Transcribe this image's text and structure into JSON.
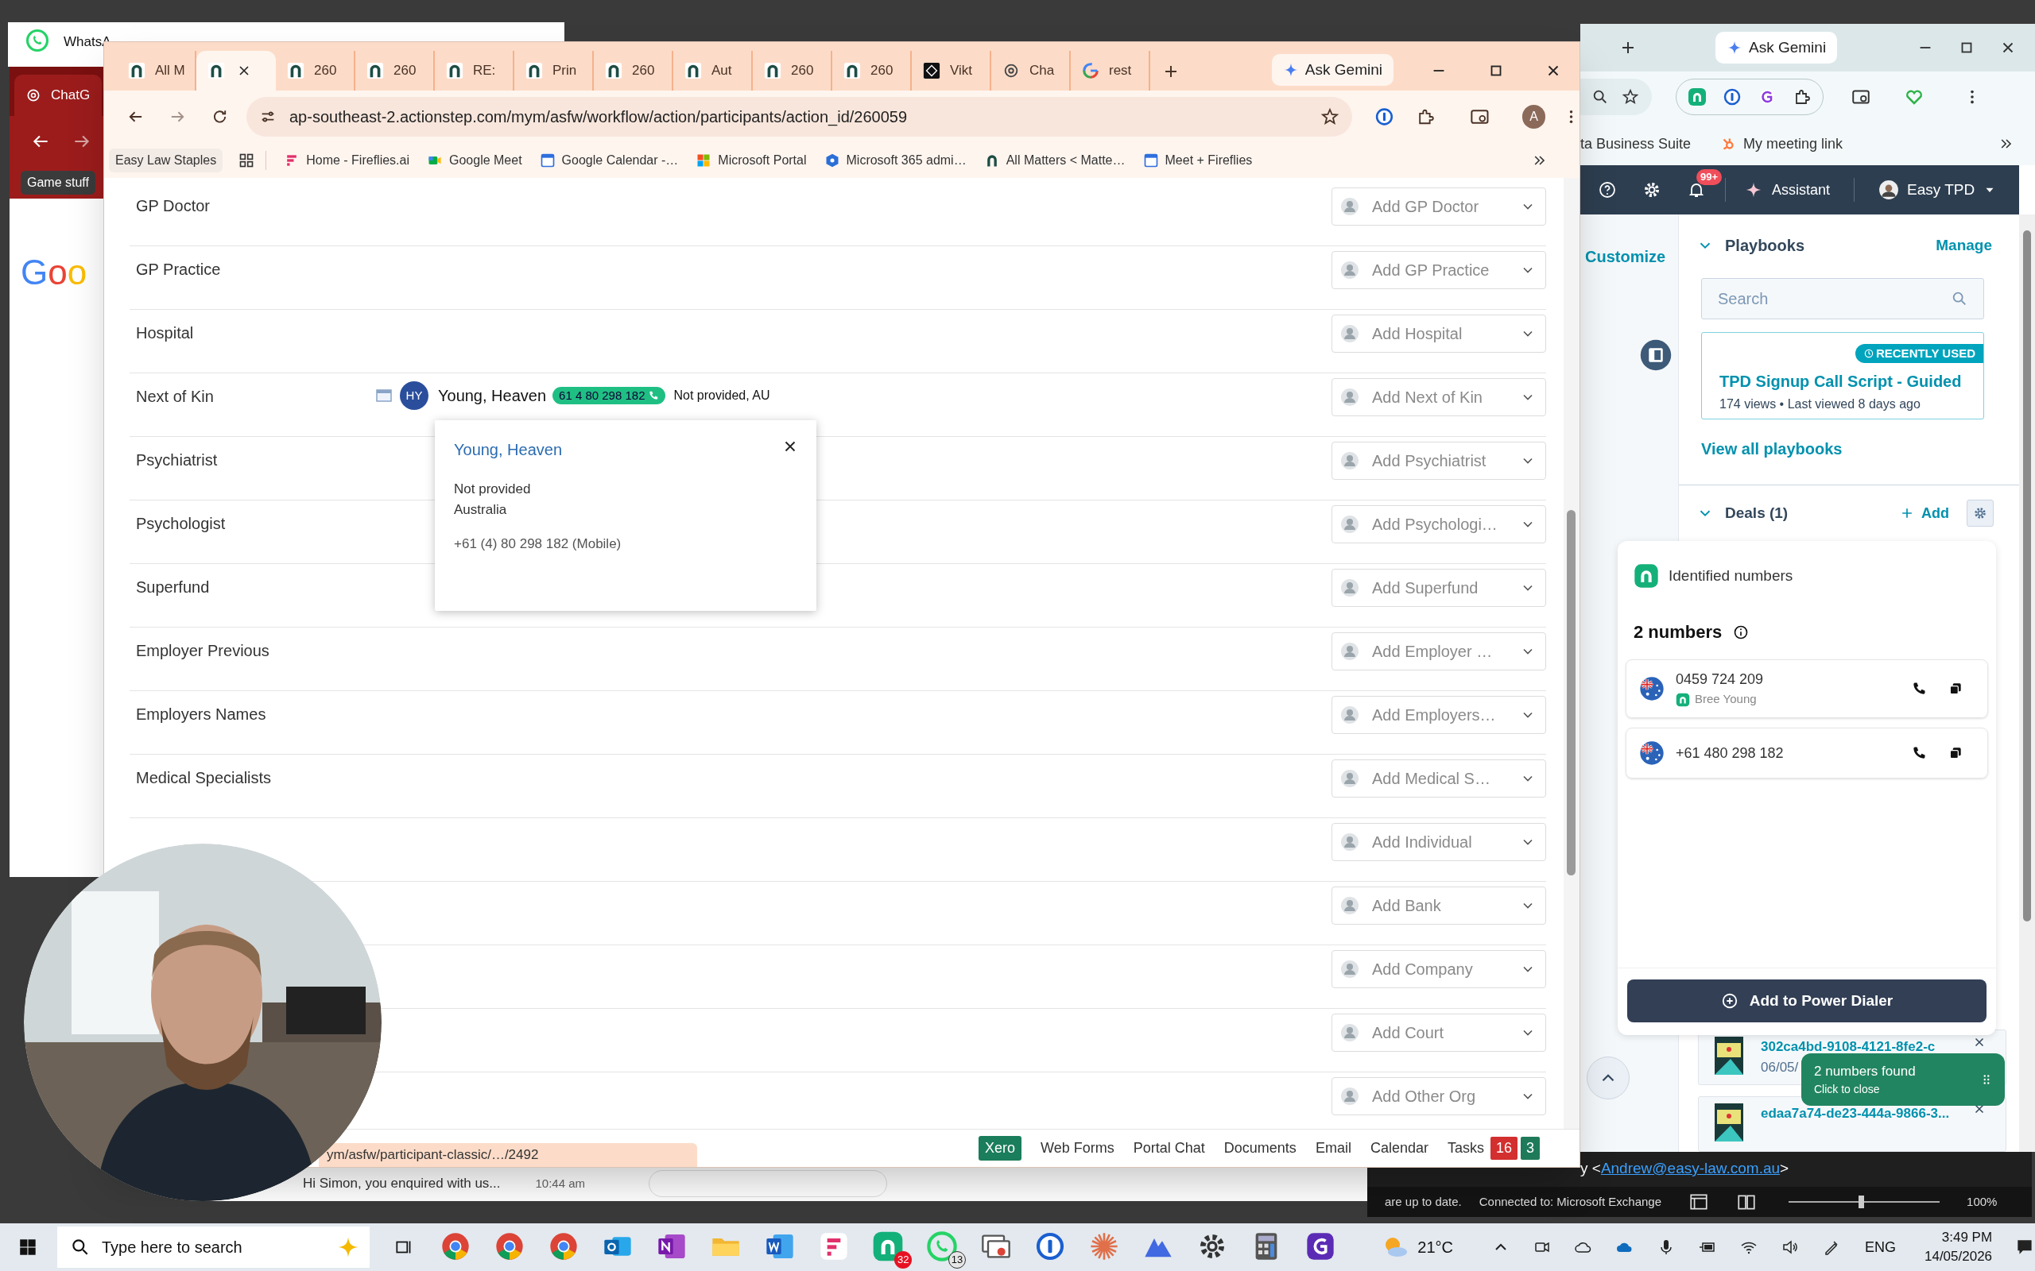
{
  "background_windows": {
    "whatsapp_title": "WhatsA",
    "chatgpt_tab": "ChatG",
    "bookmark": "Game stuff",
    "logo": "Goo",
    "chat_preview": "Hi Simon, you enquired with us...",
    "chat_time": "10:44 am"
  },
  "browser": {
    "tabs": [
      {
        "label": "All M",
        "kind": "actionstep",
        "selected": false
      },
      {
        "kind": "actionstep",
        "selected": true
      },
      {
        "label": "260",
        "kind": "actionstep",
        "selected": false
      },
      {
        "label": "260",
        "kind": "actionstep",
        "selected": false
      },
      {
        "label": "RE:",
        "kind": "actionstep",
        "selected": false
      },
      {
        "label": "Prin",
        "kind": "actionstep",
        "selected": false
      },
      {
        "label": "260",
        "kind": "actionstep",
        "selected": false
      },
      {
        "label": "Aut",
        "kind": "actionstep",
        "selected": false
      },
      {
        "label": "260",
        "kind": "actionstep",
        "selected": false
      },
      {
        "label": "260",
        "kind": "actionstep",
        "selected": false
      },
      {
        "label": "Vikt",
        "kind": "dark",
        "selected": false
      },
      {
        "label": "Cha",
        "kind": "chatgpt",
        "selected": false
      },
      {
        "label": "rest",
        "kind": "google",
        "selected": false
      }
    ],
    "gemini": "Ask Gemini",
    "profile_initial": "A",
    "address": "ap-southeast-2.actionstep.com/mym/asfw/workflow/action/participants/action_id/260059",
    "bookmarks": [
      {
        "label": "Easy Law Staples",
        "kind": "folder"
      },
      {
        "label": "Home - Fireflies.ai",
        "kind": "fireflies"
      },
      {
        "label": "Google Meet",
        "kind": "meet"
      },
      {
        "label": "Google Calendar -…",
        "kind": "calendar"
      },
      {
        "label": "Microsoft Portal",
        "kind": "microsoft"
      },
      {
        "label": "Microsoft 365 admi…",
        "kind": "admin"
      },
      {
        "label": "All Matters < Matte…",
        "kind": "actionstep"
      },
      {
        "label": "Meet + Fireflies",
        "kind": "calendar16"
      }
    ],
    "rows": [
      {
        "label": "GP Doctor",
        "action": "Add GP Doctor"
      },
      {
        "label": "GP Practice",
        "action": "Add GP Practice"
      },
      {
        "label": "Hospital",
        "action": "Add Hospital"
      },
      {
        "label": "Next of Kin",
        "action": "Add Next of Kin",
        "contact": {
          "initials": "HY",
          "name": "Young, Heaven",
          "phone": "61 4 80 298 182",
          "location": "Not provided, AU"
        }
      },
      {
        "label": "Psychiatrist",
        "action": "Add Psychiatrist"
      },
      {
        "label": "Psychologist",
        "action": "Add Psychologi…"
      },
      {
        "label": "Superfund",
        "action": "Add Superfund"
      },
      {
        "label": "Employer Previous",
        "action": "Add Employer …"
      },
      {
        "label": "Employers Names",
        "action": "Add Employers…"
      },
      {
        "label": "Medical Specialists",
        "action": "Add Medical S…"
      },
      {
        "action": "Add Individual"
      },
      {
        "action": "Add Bank"
      },
      {
        "action": "Add Company"
      },
      {
        "action": "Add Court"
      },
      {
        "action": "Add Other Org"
      }
    ],
    "popup": {
      "name": "Young, Heaven",
      "lines": [
        "Not provided",
        "Australia"
      ],
      "phone": "+61 (4) 80 298 182 (Mobile)"
    },
    "footer_links": [
      {
        "label": "Xero",
        "kind": "pill"
      },
      {
        "label": "Web Forms",
        "kind": "link"
      },
      {
        "label": "Portal Chat",
        "kind": "link"
      },
      {
        "label": "Documents",
        "kind": "link"
      },
      {
        "label": "Email",
        "kind": "link"
      },
      {
        "label": "Calendar",
        "kind": "link"
      },
      {
        "label": "Tasks",
        "kind": "link"
      }
    ],
    "task_counts": [
      {
        "count": "16",
        "color": "#d32f2f"
      },
      {
        "count": "3",
        "color": "#1f7a5a"
      }
    ],
    "status_url": "ym/asfw/participant-classic/…/2492"
  },
  "side_window": {
    "gemini": "Ask Gemini",
    "bookmarks": [
      {
        "label": "ta Business Suite",
        "kind": "none"
      },
      {
        "label": "My meeting link",
        "kind": "hubspot"
      }
    ],
    "notifications": "99+",
    "assistant": "Assistant",
    "account": "Easy TPD",
    "customize": "Customize",
    "playbooks": {
      "title": "Playbooks",
      "manage": "Manage",
      "search_placeholder": "Search",
      "card": {
        "badge": "RECENTLY USED",
        "title": "TPD Signup Call Script - Guided",
        "meta": "174 views • Last viewed 8 days ago"
      },
      "view_all": "View all playbooks"
    },
    "deals": {
      "title": "Deals (1)",
      "add": "Add"
    },
    "identified": {
      "title": "Identified numbers",
      "count": "2 numbers",
      "numbers": [
        {
          "number": "0459 724 209",
          "contact": "Bree Young"
        },
        {
          "number": "+61 480 298 182"
        }
      ],
      "button": "Add to Power Dialer"
    },
    "files": [
      {
        "name": "302ca4bd-9108-4121-8fe2-c",
        "date": "06/05/"
      },
      {
        "name": "edaa7a74-de23-444a-9866-3..."
      }
    ],
    "toast": {
      "title": "2 numbers found",
      "subtitle": "Click to close"
    }
  },
  "outlook": {
    "prefix": "y <",
    "email": "Andrew@easy-law.com.au",
    "suffix": ">",
    "sync": "are up to date.",
    "connection": "Connected to: Microsoft Exchange",
    "zoom_slider": {
      "level": 0.48
    },
    "zoom": "100%"
  },
  "taskbar": {
    "search_placeholder": "Type here to search",
    "apps": [
      {
        "kind": "chrome"
      },
      {
        "kind": "chrome"
      },
      {
        "kind": "chrome"
      },
      {
        "kind": "outlook"
      },
      {
        "kind": "onenote"
      },
      {
        "kind": "folder"
      },
      {
        "kind": "word"
      },
      {
        "kind": "fireflies"
      },
      {
        "kind": "aircall",
        "badge": "32"
      },
      {
        "kind": "whatsapp",
        "badge": "13"
      },
      {
        "kind": "windows"
      },
      {
        "kind": "onepassword"
      },
      {
        "kind": "asterisk"
      },
      {
        "kind": "mountain"
      },
      {
        "kind": "gear"
      },
      {
        "kind": "calculator"
      },
      {
        "kind": "grammar"
      }
    ],
    "weather": "21°C",
    "language": "ENG",
    "time": "3:49 PM",
    "date": "14/05/2026"
  }
}
